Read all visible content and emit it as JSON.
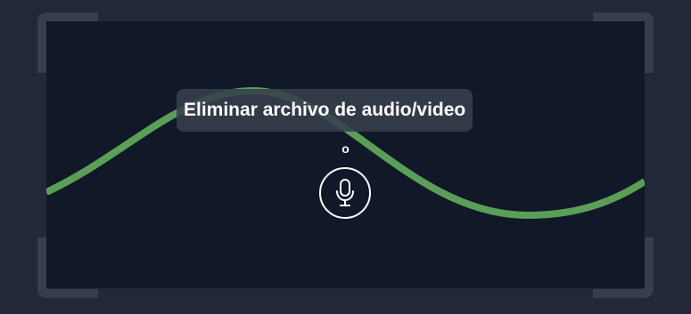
{
  "recorder": {
    "tooltip": "Eliminar archivo de audio/video",
    "counter": "o",
    "mic_icon": "microphone-icon",
    "wave_color": "#5b9e57",
    "background_color": "#111827"
  }
}
